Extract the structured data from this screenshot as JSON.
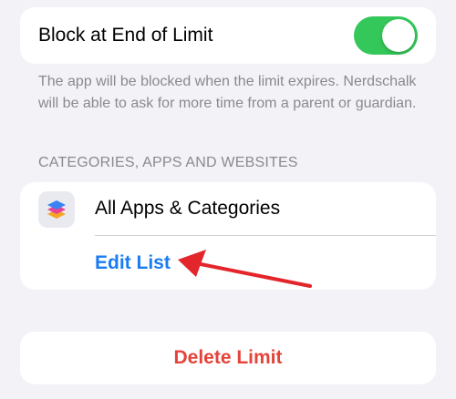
{
  "block": {
    "label": "Block at End of Limit",
    "toggle_on": true,
    "footnote": "The app will be blocked when the limit expires. Nerdschalk will be able to ask for more time from a parent or guardian."
  },
  "section": {
    "header": "CATEGORIES, APPS AND WEBSITES",
    "app_label": "All Apps & Categories",
    "app_icon": "layers-icon",
    "edit_label": "Edit List"
  },
  "actions": {
    "delete_label": "Delete Limit"
  },
  "colors": {
    "toggle_on": "#34c759",
    "link": "#1a7cf2",
    "destructive": "#e5433a",
    "annotation_arrow": "#e3262b"
  }
}
